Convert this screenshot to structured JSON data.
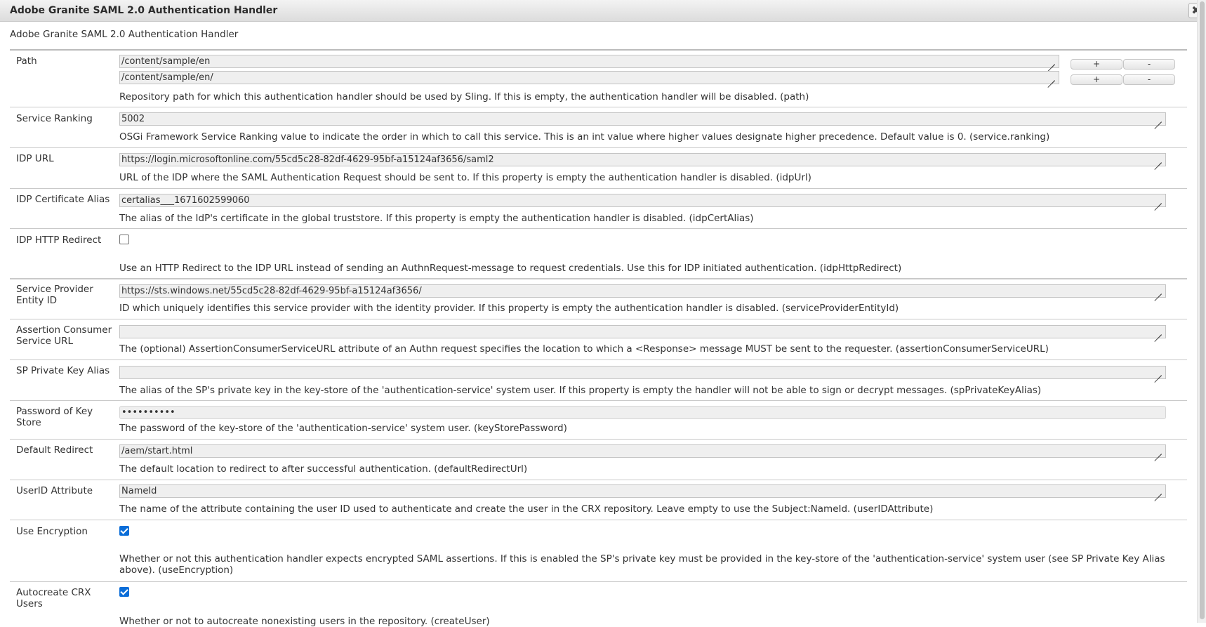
{
  "dialog": {
    "title": "Adobe Granite SAML 2.0 Authentication Handler",
    "close_label": "✖"
  },
  "form": {
    "heading": "Adobe Granite SAML 2.0 Authentication Handler",
    "path": {
      "label": "Path",
      "values": [
        "/content/sample/en",
        "/content/sample/en/"
      ],
      "add_label": "+",
      "remove_label": "-",
      "description": "Repository path for which this authentication handler should be used by Sling. If this is empty, the authentication handler will be disabled. (path)"
    },
    "service_ranking": {
      "label": "Service Ranking",
      "value": "5002",
      "description": "OSGi Framework Service Ranking value to indicate the order in which to call this service. This is an int value where higher values designate higher precedence. Default value is 0. (service.ranking)"
    },
    "idp_url": {
      "label": "IDP URL",
      "value": "https://login.microsoftonline.com/55cd5c28-82df-4629-95bf-a15124af3656/saml2",
      "description": "URL of the IDP where the SAML Authentication Request should be sent to. If this property is empty the authentication handler is disabled. (idpUrl)"
    },
    "idp_cert_alias": {
      "label": "IDP Certificate Alias",
      "value": "certalias___1671602599060",
      "description": "The alias of the IdP's certificate in the global truststore. If this property is empty the authentication handler is disabled. (idpCertAlias)"
    },
    "idp_http_redirect": {
      "label": "IDP HTTP Redirect",
      "checked": false,
      "description": "Use an HTTP Redirect to the IDP URL instead of sending an AuthnRequest-message to request credentials. Use this for IDP initiated authentication. (idpHttpRedirect)"
    },
    "sp_entity_id": {
      "label": "Service Provider Entity ID",
      "value": "https://sts.windows.net/55cd5c28-82df-4629-95bf-a15124af3656/",
      "description": "ID which uniquely identifies this service provider with the identity provider. If this property is empty the authentication handler is disabled. (serviceProviderEntityId)"
    },
    "acs_url": {
      "label": "Assertion Consumer Service URL",
      "value": "",
      "description": "The (optional) AssertionConsumerServiceURL attribute of an Authn request specifies the location to which a <Response> message MUST be sent to the requester. (assertionConsumerServiceURL)"
    },
    "sp_private_key_alias": {
      "label": "SP Private Key Alias",
      "value": "",
      "description": "The alias of the SP's private key in the key-store of the 'authentication-service' system user. If this property is empty the handler will not be able to sign or decrypt messages. (spPrivateKeyAlias)"
    },
    "key_store_password": {
      "label": "Password of Key Store",
      "value": "••••••••••",
      "description": "The password of the key-store of the 'authentication-service' system user. (keyStorePassword)"
    },
    "default_redirect": {
      "label": "Default Redirect",
      "value": "/aem/start.html",
      "description": "The default location to redirect to after successful authentication. (defaultRedirectUrl)"
    },
    "userid_attribute": {
      "label": "UserID Attribute",
      "value": "NameId",
      "description": "The name of the attribute containing the user ID used to authenticate and create the user in the CRX repository. Leave empty to use the Subject:NameId. (userIDAttribute)"
    },
    "use_encryption": {
      "label": "Use Encryption",
      "checked": true,
      "description": "Whether or not this authentication handler expects encrypted SAML assertions. If this is enabled the SP's private key must be provided in the key-store of the 'authentication-service' system user (see SP Private Key Alias above). (useEncryption)"
    },
    "autocreate_users": {
      "label": "Autocreate CRX Users",
      "checked": true,
      "description": "Whether or not to autocreate nonexisting users in the repository. (createUser)"
    }
  }
}
